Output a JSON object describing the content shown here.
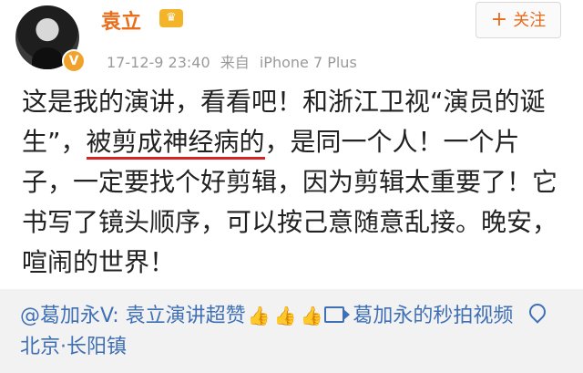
{
  "post": {
    "author": "袁立",
    "badge": "V",
    "crown_icon": "crown-icon",
    "timestamp": "17-12-9 23:40",
    "source_prefix": "来自",
    "source_device": "iPhone 7 Plus",
    "follow_label": "关注",
    "text_before": "这是我的演讲，看看吧！和浙江卫视“演员的诞生”，",
    "text_underlined": "被剪成神经病的",
    "text_after": "，是同一个人！一个片子，一定要找个好剪辑，因为剪辑太重要了！它书写了镜头顺序，可以按己意随意乱接。晚安，喧闹的世界！"
  },
  "repost": {
    "user": "@葛加永V",
    "colon": ": ",
    "text": "袁立演讲超赞",
    "thumbs": [
      "👍",
      "👍",
      "👍"
    ],
    "video_link": "葛加永的秒拍视频",
    "location": "北京·长阳镇"
  },
  "colors": {
    "username": "#e86e1b",
    "link": "#3f70b5",
    "underline": "#d62424",
    "meta": "#9a9a9a"
  }
}
